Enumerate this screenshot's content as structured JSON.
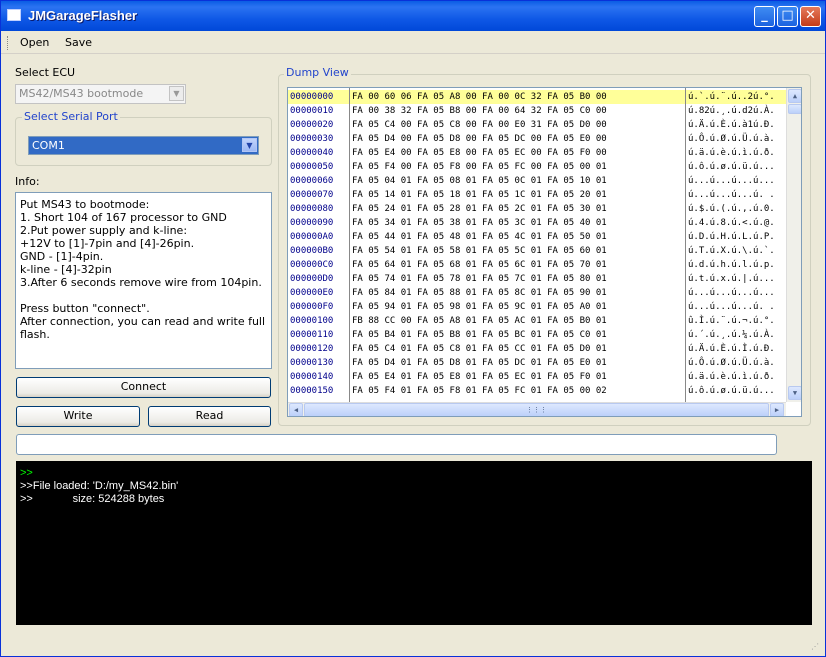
{
  "window": {
    "title": "JMGarageFlasher",
    "minimize": "_",
    "maximize": "□",
    "close": "✕"
  },
  "menu": {
    "open": "Open",
    "save": "Save"
  },
  "ecu": {
    "label": "Select ECU",
    "value": "MS42/MS43 bootmode"
  },
  "serial": {
    "group_title": "Select Serial Port",
    "value": "COM1"
  },
  "info": {
    "label": "Info:",
    "lines": [
      "Put MS43 to bootmode:",
      "1. Short 104 of 167 processor  to GND",
      "2.Put power supply and k-line:",
      "+12V to [1]-7pin and [4]-26pin.",
      "GND - [1]-4pin.",
      "k-line - [4]-32pin",
      "3.After 6 seconds remove wire from 104pin.",
      "",
      "Press button \"connect\".",
      "After connection, you can read and write full flash."
    ]
  },
  "buttons": {
    "connect": "Connect",
    "write": "Write",
    "read": "Read"
  },
  "dump": {
    "title": "Dump View",
    "rows": [
      {
        "addr": "00000000",
        "hex": "FA 00 60 06 FA 05 A8 00 FA 00 0C 32 FA 05 B0 00",
        "asc": "ú.`.ú.¨.ú..2ú.°."
      },
      {
        "addr": "00000010",
        "hex": "FA 00 38 32 FA 05 B8 00 FA 00 64 32 FA 05 C0 00",
        "asc": "ú.82ú.¸.ú.d2ú.À."
      },
      {
        "addr": "00000020",
        "hex": "FA 05 C4 00 FA 05 C8 00 FA 00 E0 31 FA 05 D0 00",
        "asc": "ú.Ä.ú.È.ú.à1ú.Ð."
      },
      {
        "addr": "00000030",
        "hex": "FA 05 D4 00 FA 05 D8 00 FA 05 DC 00 FA 05 E0 00",
        "asc": "ú.Ô.ú.Ø.ú.Ü.ú.à."
      },
      {
        "addr": "00000040",
        "hex": "FA 05 E4 00 FA 05 E8 00 FA 05 EC 00 FA 05 F0 00",
        "asc": "ú.ä.ú.è.ú.ì.ú.ð."
      },
      {
        "addr": "00000050",
        "hex": "FA 05 F4 00 FA 05 F8 00 FA 05 FC 00 FA 05 00 01",
        "asc": "ú.ô.ú.ø.ú.ü.ú..."
      },
      {
        "addr": "00000060",
        "hex": "FA 05 04 01 FA 05 08 01 FA 05 0C 01 FA 05 10 01",
        "asc": "ú...ú...ú...ú..."
      },
      {
        "addr": "00000070",
        "hex": "FA 05 14 01 FA 05 18 01 FA 05 1C 01 FA 05 20 01",
        "asc": "ú...ú...ú...ú. ."
      },
      {
        "addr": "00000080",
        "hex": "FA 05 24 01 FA 05 28 01 FA 05 2C 01 FA 05 30 01",
        "asc": "ú.$.ú.(.ú.,.ú.0."
      },
      {
        "addr": "00000090",
        "hex": "FA 05 34 01 FA 05 38 01 FA 05 3C 01 FA 05 40 01",
        "asc": "ú.4.ú.8.ú.<.ú.@."
      },
      {
        "addr": "000000A0",
        "hex": "FA 05 44 01 FA 05 48 01 FA 05 4C 01 FA 05 50 01",
        "asc": "ú.D.ú.H.ú.L.ú.P."
      },
      {
        "addr": "000000B0",
        "hex": "FA 05 54 01 FA 05 58 01 FA 05 5C 01 FA 05 60 01",
        "asc": "ú.T.ú.X.ú.\\.ú.`."
      },
      {
        "addr": "000000C0",
        "hex": "FA 05 64 01 FA 05 68 01 FA 05 6C 01 FA 05 70 01",
        "asc": "ú.d.ú.h.ú.l.ú.p."
      },
      {
        "addr": "000000D0",
        "hex": "FA 05 74 01 FA 05 78 01 FA 05 7C 01 FA 05 80 01",
        "asc": "ú.t.ú.x.ú.|.ú..."
      },
      {
        "addr": "000000E0",
        "hex": "FA 05 84 01 FA 05 88 01 FA 05 8C 01 FA 05 90 01",
        "asc": "ú...ú...ú...ú..."
      },
      {
        "addr": "000000F0",
        "hex": "FA 05 94 01 FA 05 98 01 FA 05 9C 01 FA 05 A0 01",
        "asc": "ú...ú...ú...ú. ."
      },
      {
        "addr": "00000100",
        "hex": "FB 88 CC 00 FA 05 A8 01 FA 05 AC 01 FA 05 B0 01",
        "asc": "û.Ì.ú.¨.ú.¬.ú.°."
      },
      {
        "addr": "00000110",
        "hex": "FA 05 B4 01 FA 05 B8 01 FA 05 BC 01 FA 05 C0 01",
        "asc": "ú.´.ú.¸.ú.¼.ú.À."
      },
      {
        "addr": "00000120",
        "hex": "FA 05 C4 01 FA 05 C8 01 FA 05 CC 01 FA 05 D0 01",
        "asc": "ú.Ä.ú.È.ú.Ì.ú.Ð."
      },
      {
        "addr": "00000130",
        "hex": "FA 05 D4 01 FA 05 D8 01 FA 05 DC 01 FA 05 E0 01",
        "asc": "ú.Ô.ú.Ø.ú.Ü.ú.à."
      },
      {
        "addr": "00000140",
        "hex": "FA 05 E4 01 FA 05 E8 01 FA 05 EC 01 FA 05 F0 01",
        "asc": "ú.ä.ú.è.ú.ì.ú.ð."
      },
      {
        "addr": "00000150",
        "hex": "FA 05 F4 01 FA 05 F8 01 FA 05 FC 01 FA 05 00 02",
        "asc": "ú.ô.ú.ø.ú.ü.ú..."
      }
    ]
  },
  "console": {
    "lines": [
      ">>",
      ">>File loaded: 'D:/my_MS42.bin'",
      ">>             size: 524288 bytes"
    ]
  },
  "colors": {
    "title_bar": "#0a5de4",
    "console_bg": "#000000",
    "prompt_green": "#00ff00",
    "highlight_row": "#ffff99"
  }
}
